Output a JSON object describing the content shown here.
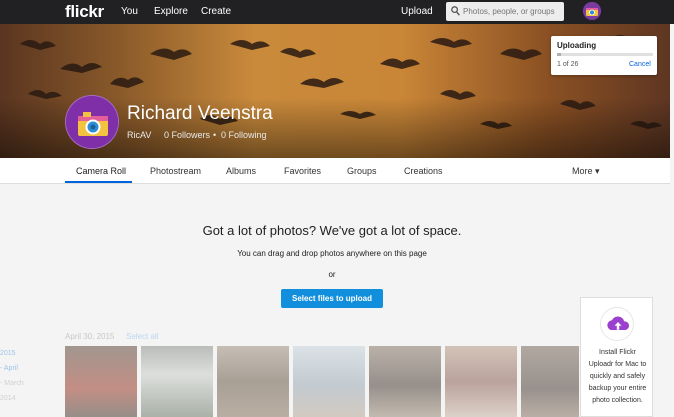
{
  "nav": {
    "logo": "flickr",
    "links": [
      "You",
      "Explore",
      "Create"
    ],
    "upload": "Upload",
    "search_placeholder": "Photos, people, or groups"
  },
  "profile": {
    "name": "Richard Veenstra",
    "username": "RicAV",
    "followers": "0 Followers",
    "following": "0 Following",
    "separator": "•"
  },
  "upload_status": {
    "title": "Uploading",
    "count": "1 of 26",
    "cancel": "Cancel",
    "progress": 0.04
  },
  "tabs": [
    "Camera Roll",
    "Photostream",
    "Albums",
    "Favorites",
    "Groups",
    "Creations"
  ],
  "more_label": "More ▾",
  "empty_state": {
    "headline": "Got a lot of photos? We've got a lot of space.",
    "drag_text": "You can drag and drop photos anywhere on this page",
    "or_text": "or",
    "button": "Select files to upload"
  },
  "camera_roll": {
    "date": "April 30, 2015",
    "select_all": "Select all",
    "side_dates": [
      "2015",
      "- April",
      "- March",
      "2014"
    ]
  },
  "promo": {
    "text_lines": [
      "Install Flickr",
      "Uploadr for Mac to",
      "quickly and safely",
      "backup your entire",
      "photo collection."
    ]
  },
  "colors": {
    "brand_blue": "#0063dc",
    "button_blue": "#128fdc",
    "nav_bg": "#212124"
  }
}
